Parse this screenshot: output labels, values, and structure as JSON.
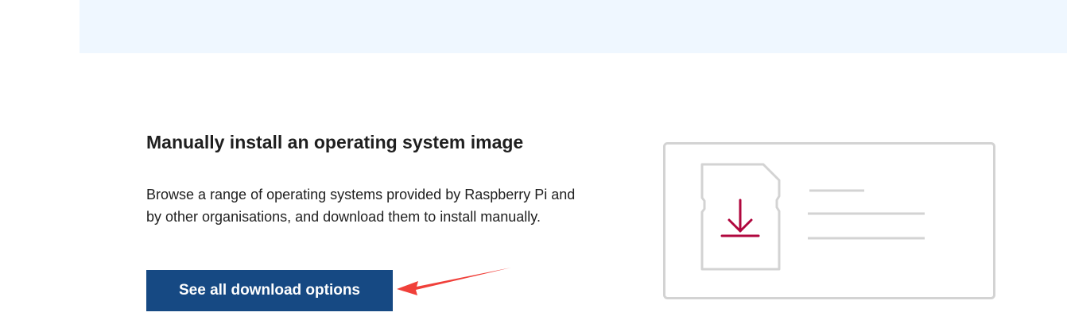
{
  "section": {
    "title": "Manually install an operating system image",
    "description": "Browse a range of operating systems provided by Raspberry Pi and by other organisations, and download them to install manually.",
    "button_label": "See all download options"
  },
  "illustration": {
    "icon": "sd-card-download-icon"
  },
  "colors": {
    "top_band": "#eff7ff",
    "button_bg": "#164983",
    "button_text": "#ffffff",
    "download_accent": "#b0073e",
    "illustration_stroke": "#d3d3d3",
    "annotation_arrow": "#f0403a"
  }
}
